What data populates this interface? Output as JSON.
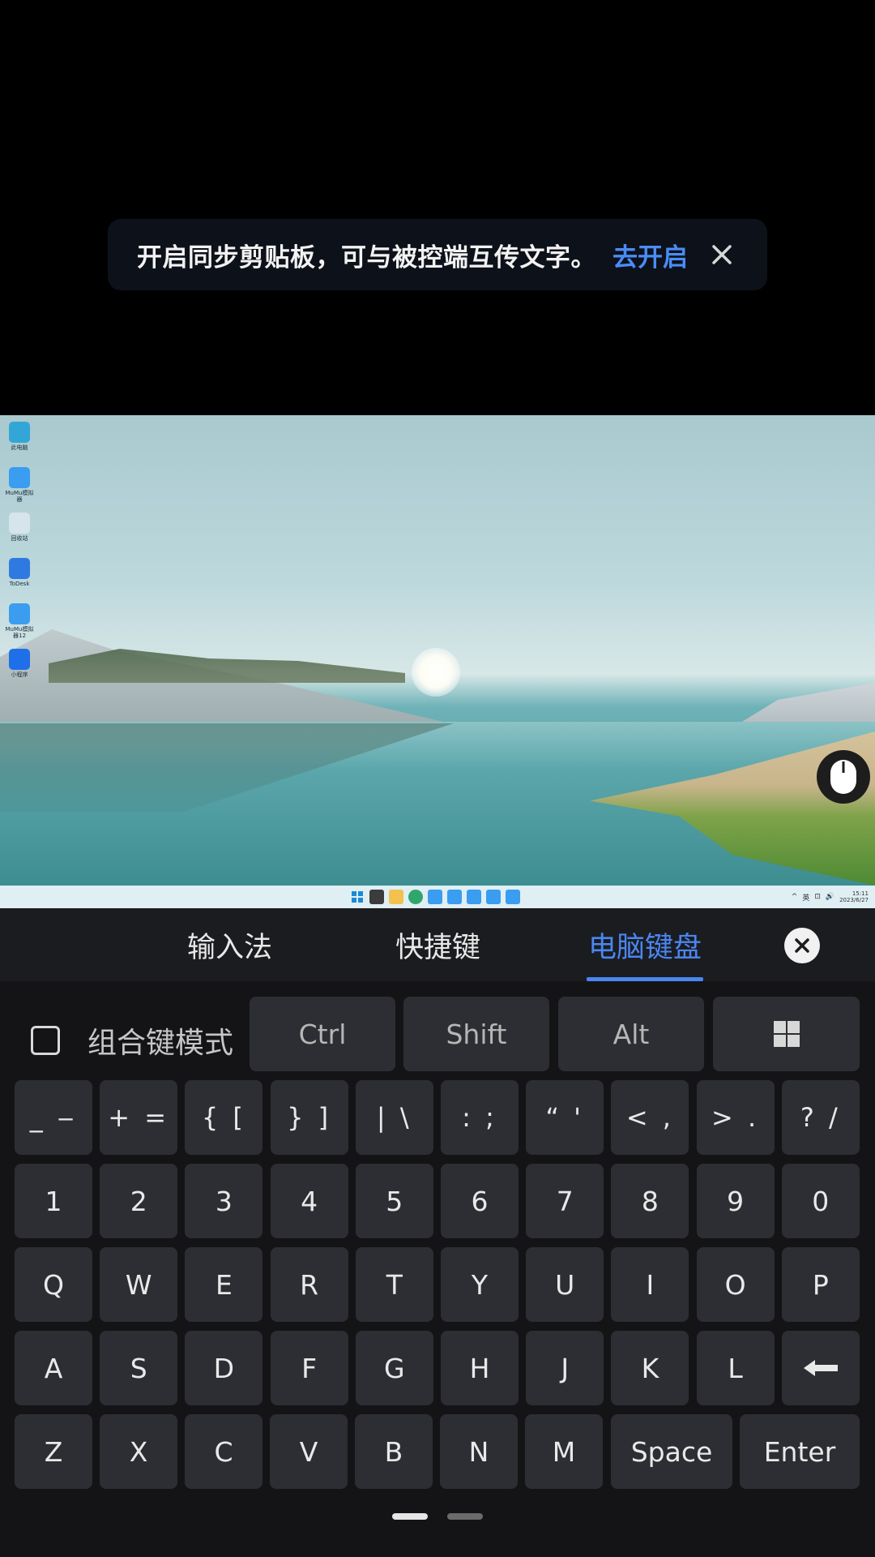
{
  "toast": {
    "message": "开启同步剪贴板，可与被控端互传文字。",
    "action": "去开启",
    "close_icon": "close-icon"
  },
  "desktop": {
    "icons": [
      {
        "name": "此电脑",
        "color": "#33a6d8"
      },
      {
        "name": "MuMu模拟器",
        "color": "#3a9df0"
      },
      {
        "name": "回收站",
        "color": "#d6e4ec"
      },
      {
        "name": "ToDesk",
        "color": "#2f7ae0"
      },
      {
        "name": "MuMu模拟器12",
        "color": "#3a9df0"
      },
      {
        "name": "小程序",
        "color": "#1f6fe8"
      }
    ],
    "mouse_button_icon": "mouse-icon"
  },
  "taskbar": {
    "tray": [
      "^",
      "英",
      "⊡",
      "🔊"
    ],
    "clock_time": "15:11",
    "clock_date": "2023/6/27"
  },
  "keyboard": {
    "tabs": [
      {
        "label": "输入法",
        "active": false
      },
      {
        "label": "快捷键",
        "active": false
      },
      {
        "label": "电脑键盘",
        "active": true
      }
    ],
    "combo_mode_label": "组合键模式",
    "modifiers": [
      "Ctrl",
      "Shift",
      "Alt"
    ],
    "windows_key_icon": "windows-icon",
    "symbol_row": [
      "_ ‒",
      "+ =",
      "{ [",
      "} ]",
      "| \\",
      ": ;",
      "“ '",
      "< ,",
      "> .",
      "? /"
    ],
    "number_row": [
      "1",
      "2",
      "3",
      "4",
      "5",
      "6",
      "7",
      "8",
      "9",
      "0"
    ],
    "row_q": [
      "Q",
      "W",
      "E",
      "R",
      "T",
      "Y",
      "U",
      "I",
      "O",
      "P"
    ],
    "row_a": [
      "A",
      "S",
      "D",
      "F",
      "G",
      "H",
      "J",
      "K",
      "L"
    ],
    "backspace_icon": "backspace-icon",
    "row_z": [
      "Z",
      "X",
      "C",
      "V",
      "B",
      "N",
      "M"
    ],
    "space_label": "Space",
    "enter_label": "Enter"
  },
  "accent_color": "#4a86f0"
}
